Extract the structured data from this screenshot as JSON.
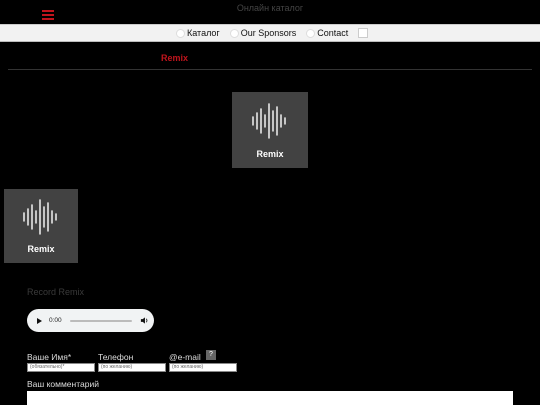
{
  "header": {
    "site_title": "Онлайн каталог"
  },
  "nav": {
    "items": [
      {
        "label": "Каталог"
      },
      {
        "label": "Our Sponsors"
      },
      {
        "label": "Contact"
      }
    ]
  },
  "section": {
    "title": "Remix"
  },
  "tiles": [
    {
      "label": "Remix"
    },
    {
      "label": "Remix"
    }
  ],
  "record": {
    "title": "Record Remix"
  },
  "player": {
    "time": "0:00",
    "progress": 0
  },
  "form": {
    "name_label": "Ваше Имя*",
    "name_placeholder": "(обязательно)*",
    "phone_label": "Телефон",
    "phone_placeholder": "(по желанию)",
    "email_label": "@e-mail",
    "email_placeholder": "(по желанию)",
    "help_label": "?",
    "comment_label": "Ваш комментарий"
  },
  "colors": {
    "accent": "#c0141c",
    "tile": "#424242",
    "nav_bg": "#f2f2f2"
  }
}
